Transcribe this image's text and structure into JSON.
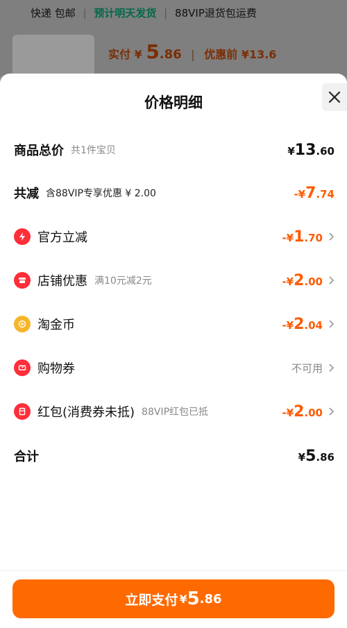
{
  "background": {
    "shipping": {
      "express": "快递 包邮",
      "eta": "预计明天发货",
      "return": "88VIP退货包运费"
    },
    "price": {
      "paid_label": "实付",
      "currency": "¥",
      "int": "5",
      "dec": ".86",
      "before": "优惠前 ¥13.6"
    }
  },
  "sheet": {
    "title": "价格明细",
    "close_icon": "close-icon"
  },
  "rows": {
    "total": {
      "label": "商品总价",
      "sub": "共1件宝贝",
      "cur": "¥",
      "int": "13",
      "dec": ".60"
    },
    "reduce": {
      "label": "共减",
      "sub": "含88VIP专享优惠 ¥ 2.00",
      "cur": "-¥",
      "int": "7",
      "dec": ".74"
    },
    "official": {
      "label": "官方立减",
      "cur": "-¥",
      "int": "1",
      "dec": ".70",
      "icon": "lightning-icon"
    },
    "shop": {
      "label": "店铺优惠",
      "sub": "满10元减2元",
      "cur": "-¥",
      "int": "2",
      "dec": ".00",
      "icon": "shop-icon"
    },
    "coin": {
      "label": "淘金币",
      "cur": "-¥",
      "int": "2",
      "dec": ".04",
      "icon": "coin-icon"
    },
    "voucher": {
      "label": "购物券",
      "status": "不可用",
      "icon": "ticket-icon"
    },
    "redpacket": {
      "label": "红包(消费券未抵)",
      "sub": "88VIP红包已抵",
      "cur": "-¥",
      "int": "2",
      "dec": ".00",
      "icon": "red-packet-icon"
    },
    "sum": {
      "label": "合计",
      "cur": "¥",
      "int": "5",
      "dec": ".86"
    }
  },
  "pay_button": {
    "label": "立即支付",
    "cur": "¥",
    "int": "5",
    "dec": ".86"
  },
  "colors": {
    "accent": "#ff6a00",
    "discount": "#ff5a00",
    "icon_red": "#ff2e3a",
    "icon_gold": "#f7b52a"
  }
}
